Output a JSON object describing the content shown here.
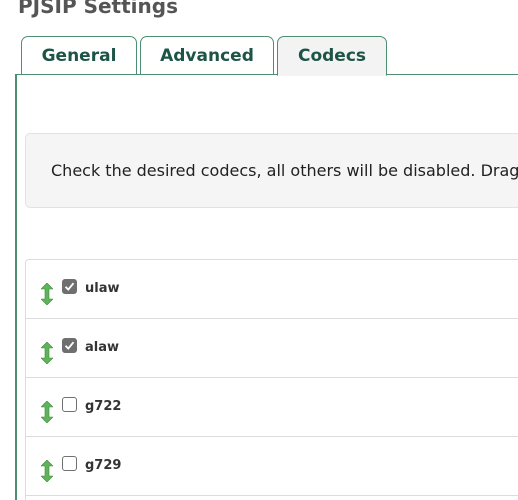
{
  "page": {
    "title": "PJSIP Settings"
  },
  "tabs": [
    {
      "label": "General",
      "active": false
    },
    {
      "label": "Advanced",
      "active": false
    },
    {
      "label": "Codecs",
      "active": true
    }
  ],
  "info": {
    "text": "Check the desired codecs, all others will be disabled. Drag to re-order."
  },
  "codecs": [
    {
      "name": "ulaw",
      "checked": true
    },
    {
      "name": "alaw",
      "checked": true
    },
    {
      "name": "g722",
      "checked": false
    },
    {
      "name": "g729",
      "checked": false
    }
  ],
  "colors": {
    "accent": "#4e8f74",
    "tab_text": "#1d5446",
    "drag_handle": "#5fb35a",
    "checkbox_checked": "#6f6f6f"
  },
  "icons": {
    "drag_handle": "drag-updown-arrow-icon",
    "check": "checkmark-icon"
  }
}
